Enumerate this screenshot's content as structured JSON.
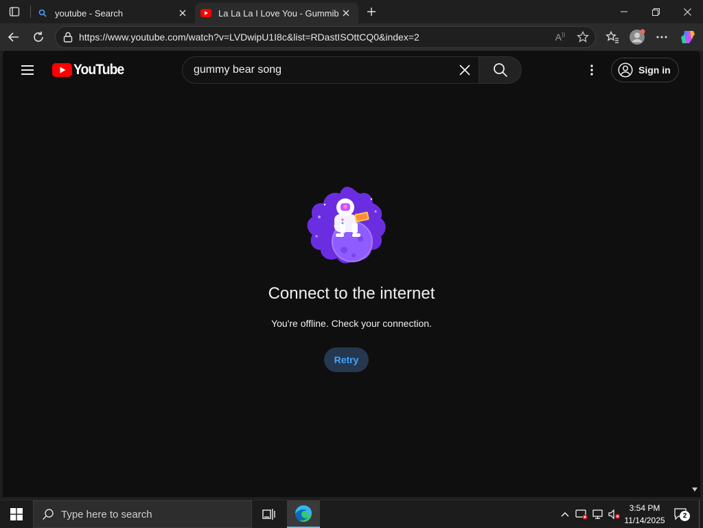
{
  "browser": {
    "tabs": [
      {
        "title": "youtube - Search",
        "active": false,
        "favicon": "search-icon"
      },
      {
        "title": "La La La I Love You - Gummibär -",
        "active": true,
        "favicon": "youtube-favicon"
      }
    ],
    "url": "https://www.youtube.com/watch?v=LVDwipU1I8c&list=RDastISOttCQ0&index=2"
  },
  "youtube": {
    "logo_text": "YouTube",
    "search_value": "gummy bear song",
    "sign_in_label": "Sign in",
    "offline": {
      "title": "Connect to the internet",
      "message": "You're offline. Check your connection.",
      "retry_label": "Retry"
    }
  },
  "taskbar": {
    "search_placeholder": "Type here to search",
    "time": "3:54 PM",
    "date": "11/14/2025",
    "notification_count": "2"
  },
  "colors": {
    "youtube_red": "#ff0000",
    "accent_blue": "#3ea6ff",
    "page_bg": "#0f0f0f"
  }
}
